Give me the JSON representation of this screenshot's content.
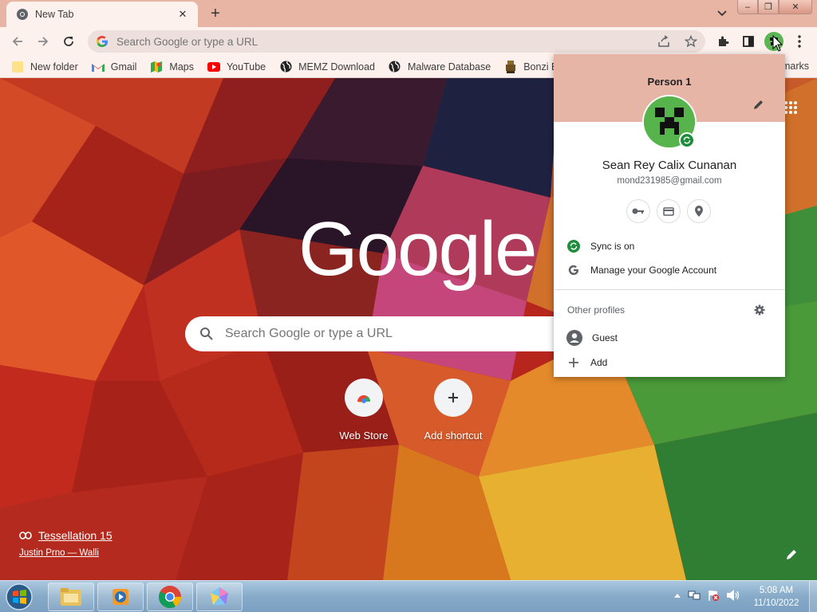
{
  "colors": {
    "frame": "#e8b4a4",
    "toolbar": "#fdf1ee",
    "profile_header": "#e7b5a5",
    "sync_green": "#1e8e3e",
    "taskbar": "#86aac8"
  },
  "tab": {
    "title": "New Tab",
    "icon": "chrome-icon",
    "close_icon": "close-icon"
  },
  "omnibox": {
    "placeholder": "Search Google or type a URL",
    "value": ""
  },
  "bookmarks": [
    {
      "label": "New folder",
      "icon": "folder-icon"
    },
    {
      "label": "Gmail",
      "icon": "gmail-icon"
    },
    {
      "label": "Maps",
      "icon": "maps-icon"
    },
    {
      "label": "YouTube",
      "icon": "youtube-icon"
    },
    {
      "label": "MEMZ Download",
      "icon": "globe-icon"
    },
    {
      "label": "Malware Database",
      "icon": "globe-icon"
    },
    {
      "label": "Bonzi BUDD",
      "icon": "bonzi-icon"
    }
  ],
  "bookmarks_other": "marks",
  "ntp": {
    "logo": "Google",
    "search_placeholder": "Search Google or type a URL",
    "shortcuts": [
      {
        "label": "Web Store",
        "icon": "webstore-icon"
      },
      {
        "label": "Add shortcut",
        "icon": "plus-icon"
      }
    ],
    "attribution_title": "Tessellation 15",
    "attribution_author": "Justin Prno — Walli"
  },
  "profile_menu": {
    "profile_name": "Person 1",
    "full_name": "Sean Rey Calix Cunanan",
    "email": "mond231985@gmail.com",
    "sync_label": "Sync is on",
    "manage_label": "Manage your Google Account",
    "other_profiles_label": "Other profiles",
    "guest_label": "Guest",
    "add_label": "Add"
  },
  "taskbar": {
    "time": "5:08 AM",
    "date": "11/10/2022"
  }
}
